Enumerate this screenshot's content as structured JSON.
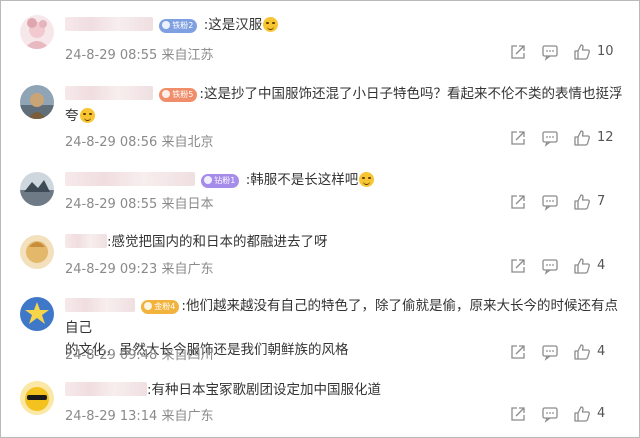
{
  "comments": [
    {
      "text": ":这是汉服",
      "time": "24-8-29 08:55",
      "loc": "来自江苏",
      "likes": "10",
      "badge": {
        "label": "铁粉2",
        "color": "#7fa0e0"
      }
    },
    {
      "text": ":这是抄了中国服饰还混了小日子特色吗？看起来不伦不类的表情也挺浮",
      "text2": "夸",
      "time": "24-8-29 08:56",
      "loc": "来自北京",
      "likes": "12",
      "badge": {
        "label": "铁粉5",
        "color": "#f08e6b"
      }
    },
    {
      "text": ":韩服不是长这样吧",
      "time": "24-8-29 08:55",
      "loc": "来自日本",
      "likes": "7",
      "badge": {
        "label": "钻粉1",
        "color": "#a58bea"
      }
    },
    {
      "text": ":感觉把国内的和日本的都融进去了呀",
      "time": "24-8-29 09:23",
      "loc": "来自广东",
      "likes": "4",
      "badge": null
    },
    {
      "text": ":他们越来越没有自己的特色了，除了偷就是偷，原来大长今的时候还有点自己",
      "text2": "的文化，虽然大长今服饰还是我们朝鲜族的风格",
      "time": "24-8-29 09:48",
      "loc": "来自四川",
      "likes": "4",
      "badge": {
        "label": "金粉4",
        "color": "#f2b33d"
      }
    },
    {
      "text": ":有种日本宝冢歌剧团设定加中国服化道",
      "time": "24-8-29 13:14",
      "loc": "来自广东",
      "likes": "4",
      "badge": null
    }
  ],
  "icons": {
    "share": "share-icon",
    "reply": "comment-icon",
    "like": "thumb-up-icon"
  },
  "colors": {
    "text": "#333333",
    "meta": "#8a8a8a",
    "icon": "#8c8c8c"
  }
}
